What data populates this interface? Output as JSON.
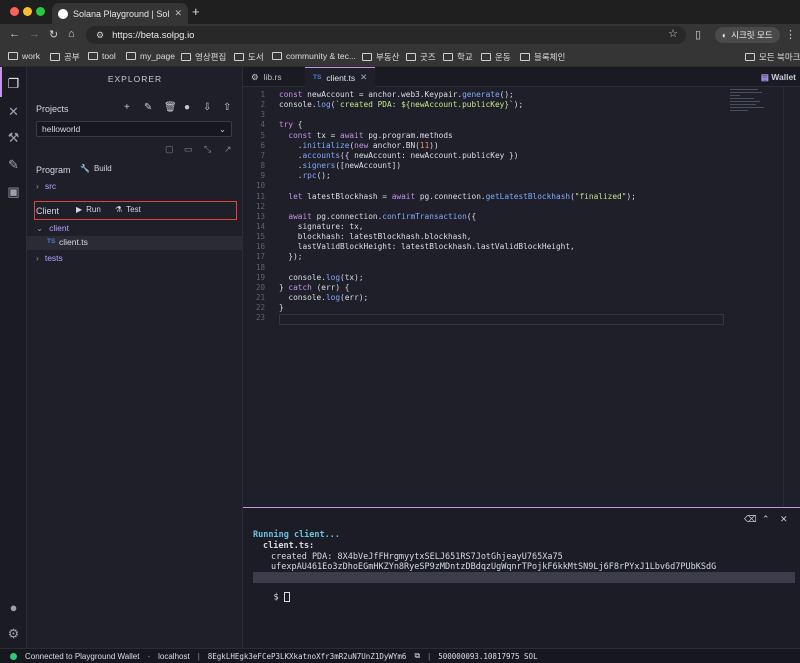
{
  "browser": {
    "tab_title": "Solana Playground | Solana IDE",
    "url": "https://beta.solpg.io",
    "incognito_label": "시크릿 모드",
    "bookmarks": [
      "work",
      "공부",
      "tool",
      "my_page",
      "영상편집",
      "도서",
      "community & tec...",
      "부동산",
      "굿즈",
      "학교",
      "운동",
      "블록체인"
    ],
    "all_bookmarks": "모든 북마크"
  },
  "explorer": {
    "title": "EXPLORER",
    "projects_label": "Projects",
    "project_value": "helloworld",
    "program_label": "Program",
    "build_label": "Build",
    "tree": {
      "src": "src",
      "client": "client",
      "client_file": "client.ts",
      "file_type": "TS",
      "tests": "tests"
    },
    "client_label": "Client",
    "run_label": "Run",
    "test_label": "Test"
  },
  "editor": {
    "tabs": [
      {
        "label": "lib.rs"
      },
      {
        "label": "client.ts",
        "type": "TS"
      }
    ],
    "wallet_label": "Wallet",
    "line_numbers": [
      "1",
      "2",
      "3",
      "4",
      "5",
      "6",
      "7",
      "8",
      "9",
      "10",
      "11",
      "12",
      "13",
      "14",
      "15",
      "16",
      "17",
      "18",
      "19",
      "20",
      "21",
      "22",
      "23"
    ],
    "lines": [
      "const newAccount = anchor.web3.Keypair.generate();",
      "console.log(`created PDA: ${newAccount.publicKey}`);",
      "",
      "try {",
      "  const tx = await pg.program.methods",
      "    .initialize(new anchor.BN(11))",
      "    .accounts({ newAccount: newAccount.publicKey })",
      "    .signers([newAccount])",
      "    .rpc();",
      "",
      "  let latestBlockhash = await pg.connection.getLatestBlockhash(\"finalized\");",
      "",
      "  await pg.connection.confirmTransaction({",
      "    signature: tx,",
      "    blockhash: latestBlockhash.blockhash,",
      "    lastValidBlockHeight: latestBlockhash.lastValidBlockHeight,",
      "  });",
      "",
      "  console.log(tx);",
      "} catch (err) {",
      "  console.log(err);",
      "}",
      ""
    ]
  },
  "terminal": {
    "running": "Running client...",
    "file": "client.ts:",
    "created": "created PDA: 8X4bVeJfFHrgmyytxSELJ651RS7JotGhjeayU765Xa75",
    "tx": "ufexpAU461Eo3zDhoEGmHKZYn8RyeSP9zMDntzDBdqzUgWqnrTPojkF6kkMtSN9Lj6F8rPYxJ1Lbv6d7PUbKSdG",
    "prompt": "$"
  },
  "status": {
    "connection": "Connected to Playground Wallet",
    "network": "localhost",
    "address": "8EgkLHEgk3eFCeP3LKXkatnoXfr3mR2uN7UnZ1DyWYm6",
    "balance": "500000093.10817975 SOL"
  },
  "colors": {
    "accent": "#c792ea",
    "highlight_box": "#e24238",
    "connected": "#2ecc71"
  }
}
